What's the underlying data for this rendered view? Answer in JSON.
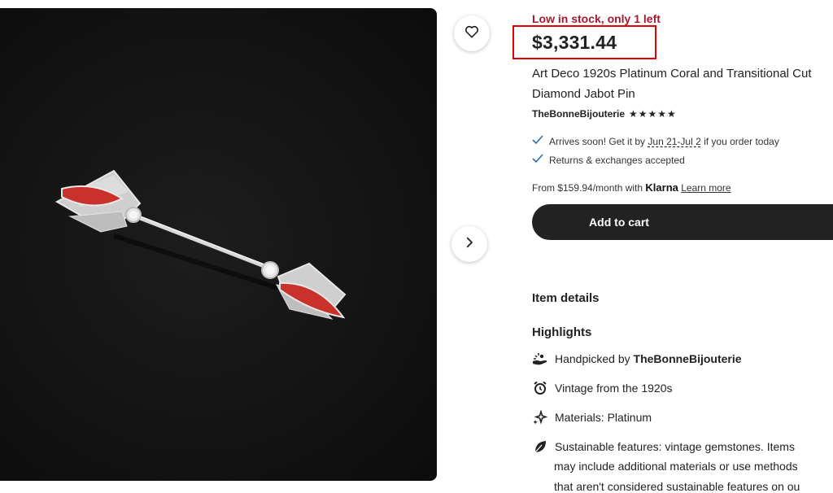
{
  "product": {
    "stock_notice": "Low in stock, only 1 left",
    "price": "$3,331.44",
    "title_line1": "Art Deco 1920s Platinum Coral and Transitional Cut",
    "title_line2": "Diamond Jabot Pin",
    "shop_name": "TheBonneBijouterie",
    "rating_stars": "★★★★★"
  },
  "shipping": {
    "arrives_prefix": "Arrives soon! Get it by ",
    "arrives_dates": "Jun 21-Jul 2",
    "arrives_suffix": " if you order today",
    "returns": "Returns & exchanges accepted"
  },
  "financing": {
    "prefix": "From $159.94/month with ",
    "provider": "Klarna",
    "learn_more": "Learn more"
  },
  "actions": {
    "add_to_cart": "Add to cart"
  },
  "details": {
    "item_details_heading": "Item details",
    "highlights_heading": "Highlights",
    "handpicked_prefix": "Handpicked by ",
    "handpicked_shop": "TheBonneBijouterie",
    "vintage": "Vintage from the 1920s",
    "materials": "Materials: Platinum",
    "sustainable_line1": "Sustainable features: vintage gemstones. Items",
    "sustainable_line2": "may include additional materials or use methods",
    "sustainable_line3": "that aren't considered sustainable features on ou"
  },
  "icons": {
    "favorite": "heart-icon",
    "next": "chevron-right-icon",
    "check": "check-icon",
    "handpicked": "hand-icon",
    "vintage": "alarm-clock-icon",
    "materials": "sparkle-icon",
    "sustainable": "leaf-icon"
  },
  "colors": {
    "stock": "#a61a2e",
    "highlight_box": "#e30000",
    "cart_button": "#222222",
    "check": "#2b6cb0"
  }
}
